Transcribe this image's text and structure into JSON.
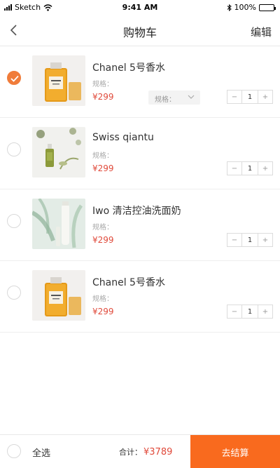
{
  "status_bar": {
    "carrier": "Sketch",
    "time": "9:41 AM",
    "battery": "100%",
    "battery_level": 1.0
  },
  "nav": {
    "title": "购物车",
    "edit_label": "编辑"
  },
  "items": [
    {
      "name": "Chanel 5号香水",
      "spec": "规格：",
      "price": "¥299",
      "spec_option": "规格：",
      "quantity": "1",
      "checked": true,
      "has_spec_select": true,
      "image": "perfume-bottle"
    },
    {
      "name": "Swiss qiantu",
      "spec": "规格：",
      "price": "¥299",
      "quantity": "1",
      "checked": false,
      "has_spec_select": false,
      "image": "green-serum-bottle"
    },
    {
      "name": "Iwo 清洁控油洗面奶",
      "spec": "规格：",
      "price": "¥299",
      "quantity": "1",
      "checked": false,
      "has_spec_select": false,
      "image": "cleanser-tube"
    },
    {
      "name": "Chanel 5号香水",
      "spec": "规格：",
      "price": "¥299",
      "quantity": "1",
      "checked": false,
      "has_spec_select": false,
      "image": "perfume-bottle"
    }
  ],
  "stepper": {
    "minus": "−",
    "plus": "+"
  },
  "bottom": {
    "select_all": "全选",
    "total_label": "合计：",
    "total_amount": "¥3789",
    "checkout_label": "去结算"
  },
  "colors": {
    "accent": "#f96a1e",
    "checked": "#f07c3a",
    "price": "#e04a3b"
  }
}
